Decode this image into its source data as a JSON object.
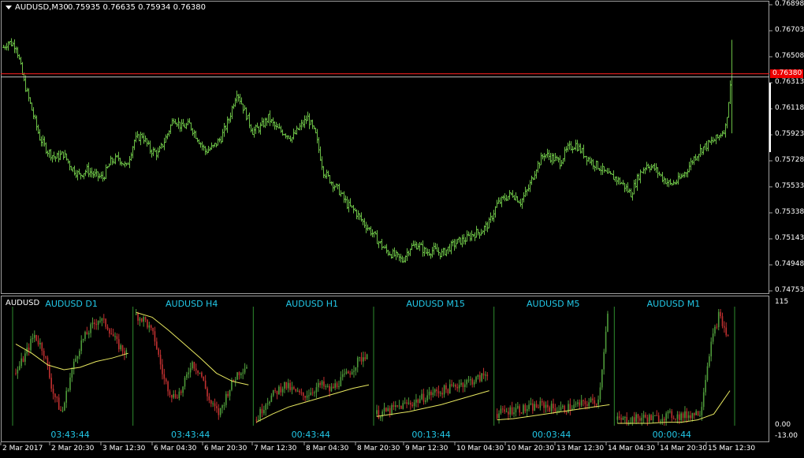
{
  "header": {
    "symbol_timeframe": "AUDUSD,M30",
    "ohlc": "0.75935 0.76635 0.75934 0.76380"
  },
  "price_axis": {
    "ticks": [
      "0.76898",
      "0.76703",
      "0.76508",
      "0.76313",
      "0.76118",
      "0.75923",
      "0.75728",
      "0.75533",
      "0.75338",
      "0.75143",
      "0.74948",
      "0.74753"
    ],
    "bid_label": "0.76380"
  },
  "indicator": {
    "name": "AUDUSD",
    "scale_top": "115",
    "scale_bottom": "0.00",
    "scale_low": "-13.00",
    "panels": [
      {
        "label": "AUDUSD D1",
        "countdown": "03:43:44"
      },
      {
        "label": "AUDUSD H4",
        "countdown": "03:43:44"
      },
      {
        "label": "AUDUSD H1",
        "countdown": "00:43:44"
      },
      {
        "label": "AUDUSD M15",
        "countdown": "00:13:44"
      },
      {
        "label": "AUDUSD M5",
        "countdown": "00:03:44"
      },
      {
        "label": "AUDUSD M1",
        "countdown": "00:00:44"
      }
    ]
  },
  "time_axis": [
    "2 Mar 2017",
    "2 Mar 20:30",
    "3 Mar 12:30",
    "6 Mar 04:30",
    "6 Mar 20:30",
    "7 Mar 12:30",
    "8 Mar 04:30",
    "8 Mar 20:30",
    "9 Mar 12:30",
    "10 Mar 04:30",
    "10 Mar 20:30",
    "13 Mar 12:30",
    "14 Mar 04:30",
    "14 Mar 20:30",
    "15 Mar 12:30"
  ],
  "colors": {
    "background": "#000000",
    "bars": "#6abd45",
    "bid_line": "#ff2020",
    "ask_line": "#c0c0c0",
    "label_cyan": "#22c8e8",
    "bull_bar": "#4e9a3a",
    "bear_bar": "#c03030",
    "ma_line": "#e8e860"
  },
  "chart_data": {
    "type": "ohlc",
    "symbol": "AUDUSD",
    "timeframe": "M30",
    "last_bar": {
      "open": 0.75935,
      "high": 0.76635,
      "low": 0.75934,
      "close": 0.7638
    },
    "price_range": [
      0.74753,
      0.76898
    ],
    "close_path": [
      [
        0,
        0.7655
      ],
      [
        10,
        0.7662
      ],
      [
        20,
        0.7659
      ],
      [
        30,
        0.7632
      ],
      [
        40,
        0.7611
      ],
      [
        50,
        0.759
      ],
      [
        60,
        0.758
      ],
      [
        70,
        0.7575
      ],
      [
        80,
        0.7578
      ],
      [
        90,
        0.7568
      ],
      [
        100,
        0.7562
      ],
      [
        110,
        0.7566
      ],
      [
        120,
        0.7562
      ],
      [
        130,
        0.756
      ],
      [
        140,
        0.7572
      ],
      [
        150,
        0.7575
      ],
      [
        160,
        0.7568
      ],
      [
        170,
        0.7588
      ],
      [
        180,
        0.7592
      ],
      [
        190,
        0.7581
      ],
      [
        200,
        0.7578
      ],
      [
        210,
        0.759
      ],
      [
        220,
        0.7605
      ],
      [
        230,
        0.7598
      ],
      [
        240,
        0.76
      ],
      [
        250,
        0.759
      ],
      [
        260,
        0.758
      ],
      [
        270,
        0.7583
      ],
      [
        280,
        0.759
      ],
      [
        290,
        0.7604
      ],
      [
        300,
        0.7625
      ],
      [
        310,
        0.761
      ],
      [
        320,
        0.7595
      ],
      [
        330,
        0.7598
      ],
      [
        340,
        0.7605
      ],
      [
        350,
        0.7597
      ],
      [
        360,
        0.7594
      ],
      [
        370,
        0.759
      ],
      [
        380,
        0.7598
      ],
      [
        390,
        0.7605
      ],
      [
        400,
        0.7592
      ],
      [
        410,
        0.7565
      ],
      [
        420,
        0.7557
      ],
      [
        430,
        0.755
      ],
      [
        440,
        0.754
      ],
      [
        450,
        0.7535
      ],
      [
        460,
        0.7527
      ],
      [
        470,
        0.752
      ],
      [
        480,
        0.7512
      ],
      [
        490,
        0.7505
      ],
      [
        500,
        0.7502
      ],
      [
        510,
        0.7498
      ],
      [
        520,
        0.7508
      ],
      [
        530,
        0.751
      ],
      [
        540,
        0.7504
      ],
      [
        550,
        0.7506
      ],
      [
        560,
        0.7503
      ],
      [
        570,
        0.7508
      ],
      [
        580,
        0.7512
      ],
      [
        590,
        0.7514
      ],
      [
        600,
        0.7518
      ],
      [
        610,
        0.752
      ],
      [
        620,
        0.7526
      ],
      [
        630,
        0.754
      ],
      [
        640,
        0.7545
      ],
      [
        650,
        0.7548
      ],
      [
        660,
        0.7542
      ],
      [
        670,
        0.7552
      ],
      [
        680,
        0.7568
      ],
      [
        690,
        0.7578
      ],
      [
        700,
        0.7575
      ],
      [
        710,
        0.7572
      ],
      [
        720,
        0.7582
      ],
      [
        730,
        0.7585
      ],
      [
        740,
        0.7578
      ],
      [
        750,
        0.7572
      ],
      [
        760,
        0.7568
      ],
      [
        770,
        0.7562
      ],
      [
        780,
        0.756
      ],
      [
        790,
        0.7555
      ],
      [
        800,
        0.7548
      ],
      [
        810,
        0.7562
      ],
      [
        820,
        0.757
      ],
      [
        830,
        0.7567
      ],
      [
        840,
        0.756
      ],
      [
        850,
        0.7555
      ],
      [
        860,
        0.7558
      ],
      [
        870,
        0.7565
      ],
      [
        880,
        0.7575
      ],
      [
        890,
        0.7582
      ],
      [
        900,
        0.7586
      ],
      [
        910,
        0.759
      ],
      [
        920,
        0.7598
      ],
      [
        928,
        0.7638
      ]
    ]
  }
}
